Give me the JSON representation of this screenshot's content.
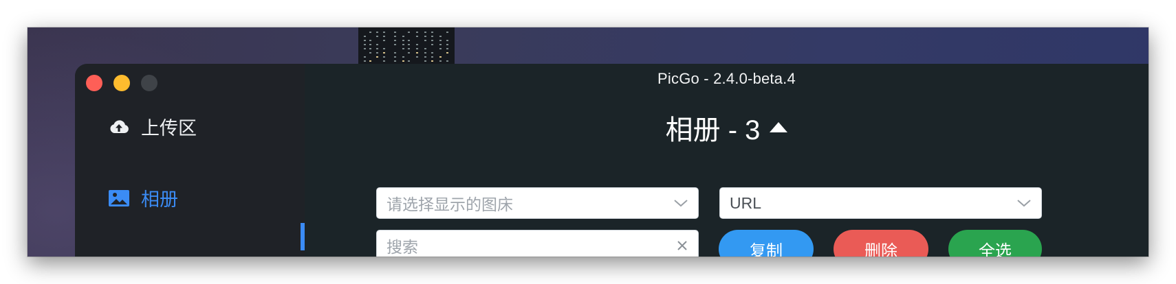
{
  "window": {
    "title": "PicGo - 2.4.0-beta.4"
  },
  "sidebar": {
    "items": [
      {
        "label": "上传区",
        "icon": "cloud-upload-icon",
        "active": false
      },
      {
        "label": "相册",
        "icon": "image-icon",
        "active": true
      }
    ]
  },
  "gallery": {
    "title": "相册 - 3",
    "toggle_icon": "caret-up-icon",
    "bed_select": {
      "placeholder": "请选择显示的图床"
    },
    "format_select": {
      "value": "URL"
    },
    "search": {
      "placeholder": "搜索"
    },
    "buttons": {
      "copy": "复制",
      "delete": "删除",
      "select_all": "全选"
    }
  },
  "colors": {
    "accent": "#3b8cf5",
    "copy": "#3399f2",
    "delete": "#ea5b56",
    "select_all": "#2aa44f"
  }
}
